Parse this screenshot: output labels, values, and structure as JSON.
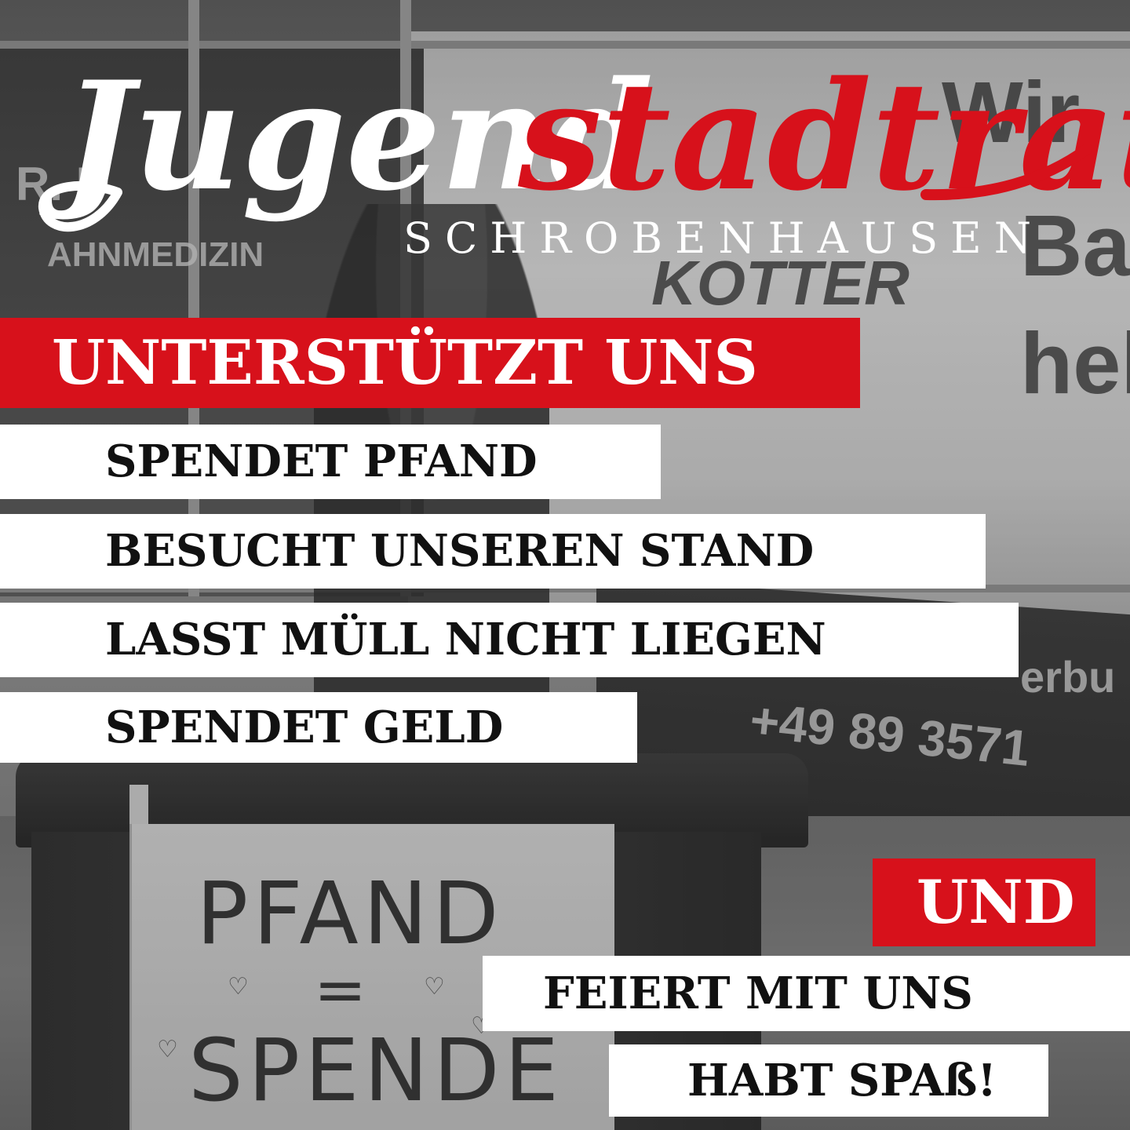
{
  "logo": {
    "word_white": "Jugend",
    "word_red": "stadtrat",
    "subtitle": "SCHROBENHAUSEN",
    "red_color": "#d7111b"
  },
  "headline": "UNTERSTÜTZT UNS",
  "actions": [
    "SPENDET PFAND",
    "BESUCHT UNSEREN STAND",
    "LASST MÜLL NICHT LIEGEN",
    "SPENDET GELD"
  ],
  "connector": "UND",
  "extras": [
    "FEIERT MIT UNS",
    "HABT SPAß!"
  ],
  "background": {
    "sign_left": "R. D",
    "sign_left_2": "AHNMEDIZIN",
    "sign_right_1": "Wir",
    "sign_right_2": "Bay",
    "sign_right_3": "KOTTER",
    "sign_right_4": "hel",
    "sign_right_5": "erbu",
    "sign_right_6": "+49 89 3571",
    "board_line_1": "PFAND",
    "board_line_2": "=",
    "board_line_3": "SPENDE"
  }
}
